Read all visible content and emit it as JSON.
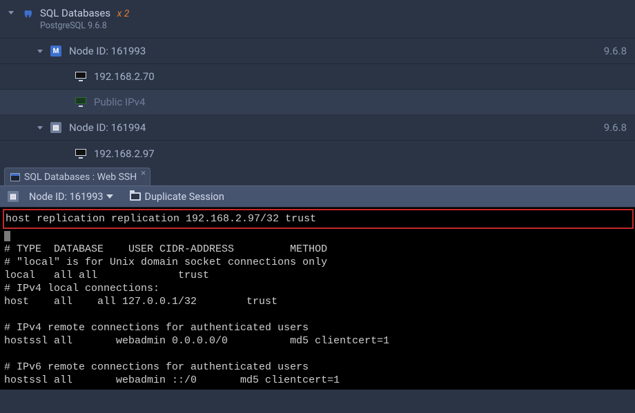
{
  "group": {
    "title": "SQL Databases",
    "count_badge": "x 2",
    "subtitle": "PostgreSQL 9.6.8"
  },
  "nodes": [
    {
      "id_label": "Node ID: 161993",
      "version": "9.6.8",
      "badge_letter": "M",
      "ip": "192.168.2.70",
      "public_label": "Public IPv4"
    },
    {
      "id_label": "Node ID: 161994",
      "version": "9.6.8",
      "badge_letter": "",
      "ip": "192.168.2.97"
    }
  ],
  "tab": {
    "label": "SQL Databases : Web SSH"
  },
  "toolbar": {
    "node_label": "Node ID: 161993",
    "duplicate_label": "Duplicate Session"
  },
  "terminal": {
    "highlight_line": "host replication  replication       192.168.2.97/32     trust",
    "lines": [
      "# TYPE  DATABASE    USER CIDR-ADDRESS         METHOD",
      "# \"local\" is for Unix domain socket connections only",
      "local   all all             trust",
      "# IPv4 local connections:",
      "host    all    all 127.0.0.1/32        trust",
      "",
      "# IPv4 remote connections for authenticated users",
      "hostssl all       webadmin 0.0.0.0/0          md5 clientcert=1",
      "",
      "# IPv6 remote connections for authenticated users",
      "hostssl all       webadmin ::/0       md5 clientcert=1"
    ],
    "tilde": "~"
  }
}
